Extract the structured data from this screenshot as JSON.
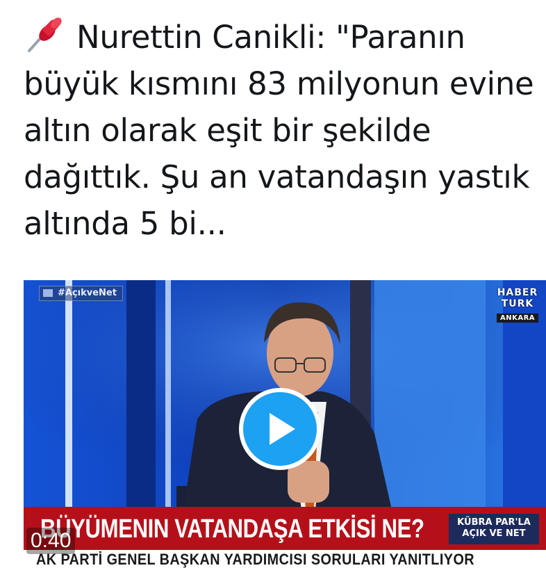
{
  "tweet": {
    "pin_icon": "pushpin-icon",
    "text": "Nurettin Canikli: \"Paranın büyük kısmını 83 milyonun evine altın olarak eşit bir şekilde dağıttık. Şu an vatandaşın yastık altında 5 bi..."
  },
  "video": {
    "hashtag": "#AçıkveNet",
    "channel_line1": "HABER",
    "channel_line2": "TURK",
    "channel_location": "ANKARA",
    "headline": "BÜYÜMENIN VATANDAŞA ETKİSİ NE?",
    "show_line1": "KÜBRA PAR'LA",
    "show_line2": "AÇIK VE NET",
    "subheadline": "AK PARTİ GENEL BAŞKAN YARDIMCISI SORULARI YANITLIYOR",
    "duration": "0:40",
    "play_icon": "play-icon"
  },
  "colors": {
    "accent": "#1da1f2",
    "ticker_red": "#b5101a",
    "text": "#14171a"
  }
}
